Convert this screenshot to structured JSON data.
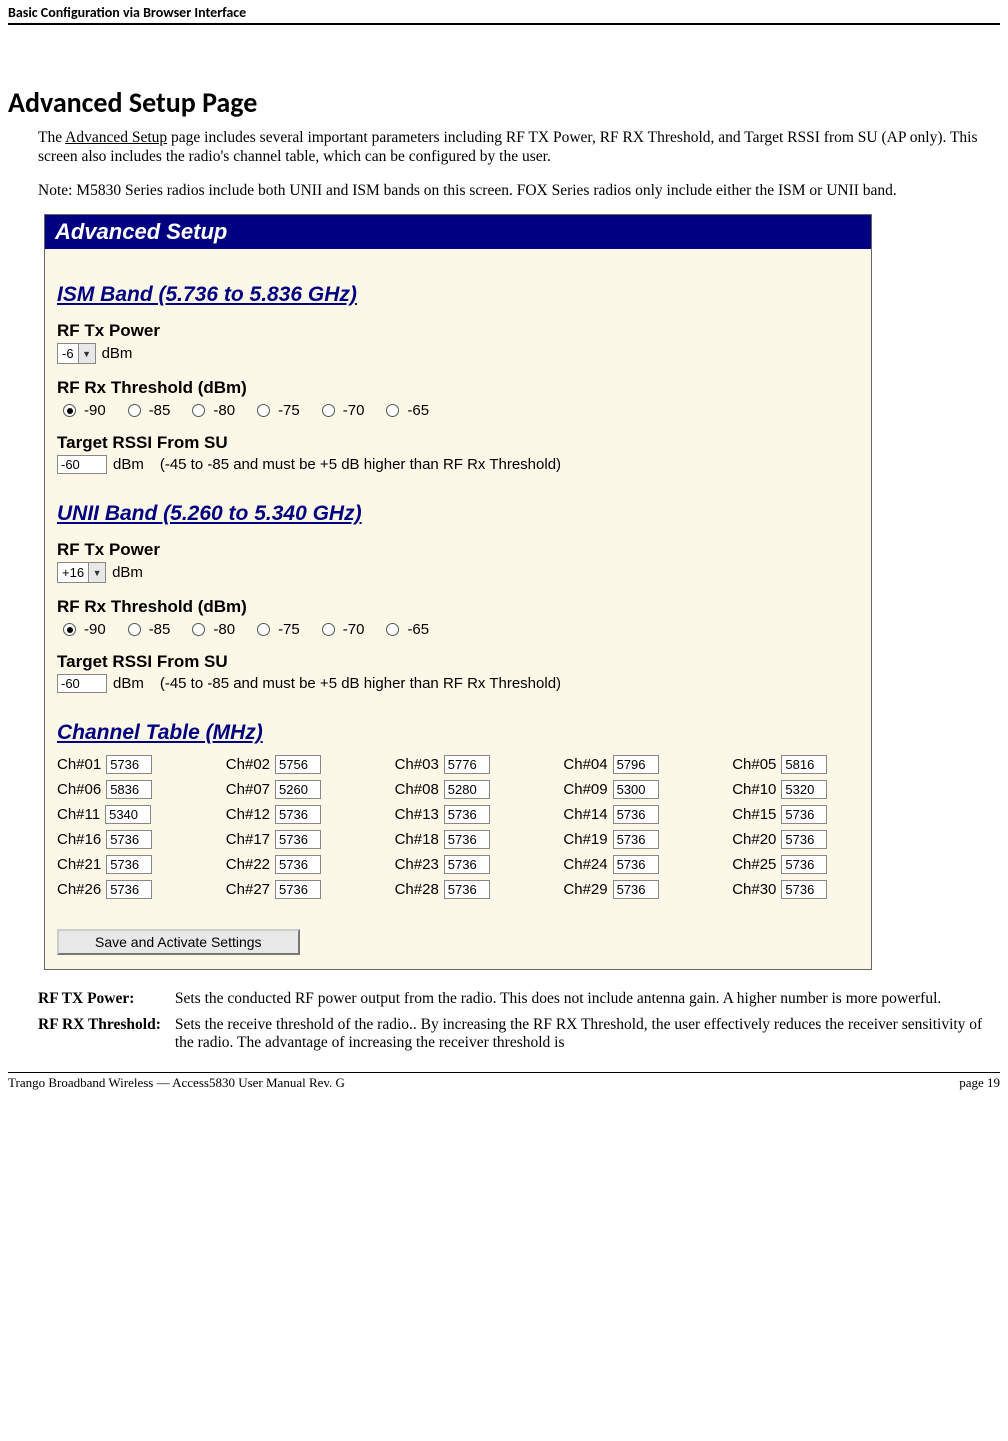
{
  "header": "Basic Configuration via Browser Interface",
  "h1": "Advanced Setup Page",
  "intro1a": "The ",
  "intro1_link": "Advanced Setup",
  "intro1b": " page includes several important parameters including RF TX Power, RF RX Threshold, and Target RSSI from SU (AP only).  This screen also includes the radio's channel table, which can be configured by the user.",
  "intro2": "Note:  M5830 Series radios include both UNII and ISM bands on this screen.  FOX Series radios only include either the ISM or UNII band.",
  "adv": {
    "title": "Advanced Setup",
    "ism_title": "ISM Band (5.736 to 5.836 GHz)",
    "unii_title": "UNII Band (5.260 to 5.340 GHz)",
    "rf_tx_label": "RF Tx Power",
    "rf_rx_label": "RF Rx Threshold (dBm)",
    "target_label": "Target RSSI From SU",
    "dbm": "dBm",
    "target_hint": "(-45 to -85 and must be +5 dB higher than RF Rx Threshold)",
    "ism_tx_val": "-6",
    "unii_tx_val": "+16",
    "target_val": "-60",
    "rx_options": [
      "-90",
      "-85",
      "-80",
      "-75",
      "-70",
      "-65"
    ],
    "channel_title": "Channel Table (MHz)",
    "channels": [
      {
        "l": "Ch#01",
        "v": "5736"
      },
      {
        "l": "Ch#02",
        "v": "5756"
      },
      {
        "l": "Ch#03",
        "v": "5776"
      },
      {
        "l": "Ch#04",
        "v": "5796"
      },
      {
        "l": "Ch#05",
        "v": "5816"
      },
      {
        "l": "Ch#06",
        "v": "5836"
      },
      {
        "l": "Ch#07",
        "v": "5260"
      },
      {
        "l": "Ch#08",
        "v": "5280"
      },
      {
        "l": "Ch#09",
        "v": "5300"
      },
      {
        "l": "Ch#10",
        "v": "5320"
      },
      {
        "l": "Ch#11",
        "v": "5340"
      },
      {
        "l": "Ch#12",
        "v": "5736"
      },
      {
        "l": "Ch#13",
        "v": "5736"
      },
      {
        "l": "Ch#14",
        "v": "5736"
      },
      {
        "l": "Ch#15",
        "v": "5736"
      },
      {
        "l": "Ch#16",
        "v": "5736"
      },
      {
        "l": "Ch#17",
        "v": "5736"
      },
      {
        "l": "Ch#18",
        "v": "5736"
      },
      {
        "l": "Ch#19",
        "v": "5736"
      },
      {
        "l": "Ch#20",
        "v": "5736"
      },
      {
        "l": "Ch#21",
        "v": "5736"
      },
      {
        "l": "Ch#22",
        "v": "5736"
      },
      {
        "l": "Ch#23",
        "v": "5736"
      },
      {
        "l": "Ch#24",
        "v": "5736"
      },
      {
        "l": "Ch#25",
        "v": "5736"
      },
      {
        "l": "Ch#26",
        "v": "5736"
      },
      {
        "l": "Ch#27",
        "v": "5736"
      },
      {
        "l": "Ch#28",
        "v": "5736"
      },
      {
        "l": "Ch#29",
        "v": "5736"
      },
      {
        "l": "Ch#30",
        "v": "5736"
      }
    ],
    "save": "Save and Activate Settings"
  },
  "defs": {
    "t1": "RF TX Power:",
    "d1": "Sets the conducted RF power output from the radio.  This does not include antenna gain.  A higher number is more powerful.",
    "t2": "RF RX Threshold:",
    "d2": "Sets the receive threshold of the radio..  By increasing the RF RX Threshold, the user effectively reduces the receiver sensitivity of the radio.  The advantage of increasing the receiver threshold is"
  },
  "footer_left": "Trango Broadband Wireless — Access5830 User Manual  Rev. G",
  "footer_right": "page 19"
}
